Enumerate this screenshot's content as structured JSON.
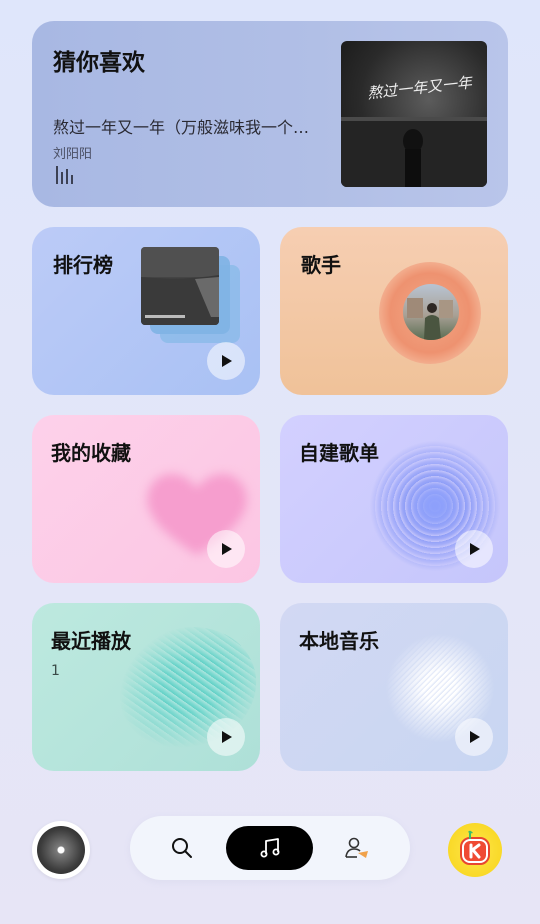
{
  "guess_you_like": {
    "title": "猜你喜欢",
    "song": "熬过一年又一年（万般滋味我一个人...",
    "artist": "刘阳阳",
    "cover_text": "熬过一年又一年"
  },
  "ranking": {
    "title": "排行榜"
  },
  "singer": {
    "title": "歌手"
  },
  "favorites": {
    "title": "我的收藏"
  },
  "custom_playlist": {
    "title": "自建歌单"
  },
  "recent": {
    "title": "最近播放",
    "count": "1"
  },
  "local_music": {
    "title": "本地音乐"
  },
  "colors": {
    "nav_active": "#000000",
    "hero_bg": "#aebde5",
    "singer_bg": "#f3c7a6",
    "favorites_bg": "#fccde7",
    "playlist_bg": "#ccccfd",
    "recent_bg": "#b5e5dc",
    "local_bg": "#cdd7f2"
  },
  "icons": {
    "nav": [
      "search-icon",
      "music-note-icon",
      "profile-icon"
    ],
    "card_action": "play-icon",
    "app": "kugou-icon"
  }
}
